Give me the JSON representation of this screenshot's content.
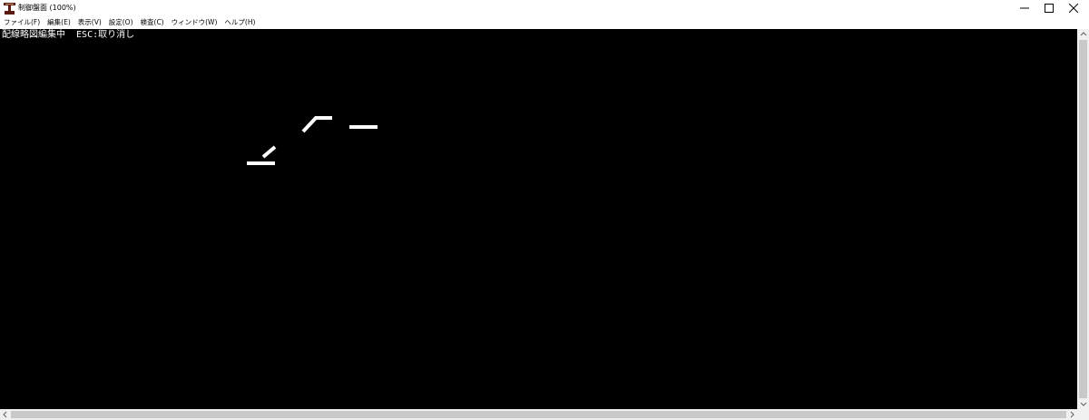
{
  "window": {
    "title": "制御盤面 (100%)",
    "controls": {
      "minimize": "—",
      "maximize": "☐",
      "close": "✕"
    }
  },
  "menu": [
    {
      "label": "ファイル(F)"
    },
    {
      "label": "編集(E)"
    },
    {
      "label": "表示(V)"
    },
    {
      "label": "設定(O)"
    },
    {
      "label": "検査(C)"
    },
    {
      "label": "ウィンドウ(W)"
    },
    {
      "label": "ヘルプ(H)"
    }
  ],
  "canvas": {
    "status_text": "配線略図編集中  ESC:取り消し",
    "background": "#000000",
    "line_color": "#ffffff"
  }
}
